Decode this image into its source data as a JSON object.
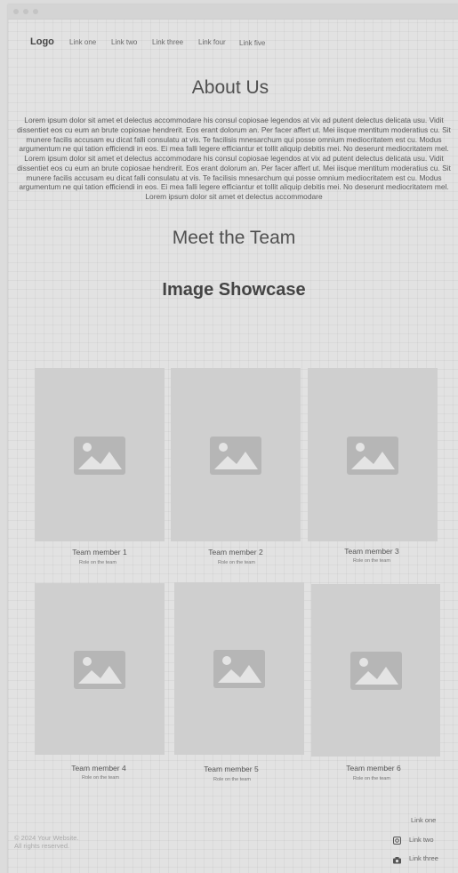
{
  "nav": {
    "logo": "Logo",
    "links": [
      "Link one",
      "Link two",
      "Link three",
      "Link four",
      "Link five"
    ]
  },
  "about": {
    "title": "About Us",
    "body": "Lorem ipsum dolor sit amet et delectus accommodare his consul copiosae legendos at vix ad putent delectus delicata usu. Vidit dissentiet eos cu eum an brute copiosae hendrerit. Eos erant dolorum an. Per facer affert ut. Mei iisque mentitum moderatius cu. Sit munere facilis accusam eu dicat falli consulatu at vis. Te facilisis mnesarchum qui posse omnium mediocritatem est cu. Modus argumentum ne qui tation efficiendi in eos. Ei mea falli legere efficiantur et tollit aliquip debitis mei. No deserunt mediocritatem mel. Lorem ipsum dolor sit amet et delectus accommodare his consul copiosae legendos at vix ad putent delectus delicata usu. Vidit dissentiet eos cu eum an brute copiosae hendrerit. Eos erant dolorum an. Per facer affert ut. Mei iisque mentitum moderatius cu. Sit munere facilis accusam eu dicat falli consulatu at vis. Te facilisis mnesarchum qui posse omnium mediocritatem est cu. Modus argumentum ne qui tation efficiendi in eos. Ei mea falli legere efficiantur et tollit aliquip debitis mei. No deserunt mediocritatem mel. Lorem ipsum dolor sit amet et delectus accommodare"
  },
  "team": {
    "title": "Meet the Team",
    "showcase_title": "Image Showcase",
    "members": [
      {
        "name": "Team member 1",
        "role": "Role on the team",
        "icon": "image-placeholder-icon"
      },
      {
        "name": "Team member 2",
        "role": "Role on the team",
        "icon": "image-placeholder-icon"
      },
      {
        "name": "Team member 3",
        "role": "Role on the team",
        "icon": "image-placeholder-icon"
      },
      {
        "name": "Team member 4",
        "role": "Role on the team",
        "icon": "image-placeholder-icon"
      },
      {
        "name": "Team member 5",
        "role": "Role on the team",
        "icon": "image-placeholder-icon"
      },
      {
        "name": "Team member 6",
        "role": "Role on the team",
        "icon": "image-placeholder-icon"
      }
    ]
  },
  "footer": {
    "copyright": "© 2024 Your Website.",
    "rights": "All rights reserved.",
    "links": [
      {
        "label": "Link one",
        "icon": ""
      },
      {
        "label": "Link two",
        "icon": "instagram-icon"
      },
      {
        "label": "Link three",
        "icon": "camera-icon"
      }
    ]
  },
  "colors": {
    "background": "#e2e2e2",
    "placeholder": "#cfcfcf",
    "placeholder_icon": "#b6b6b6"
  }
}
